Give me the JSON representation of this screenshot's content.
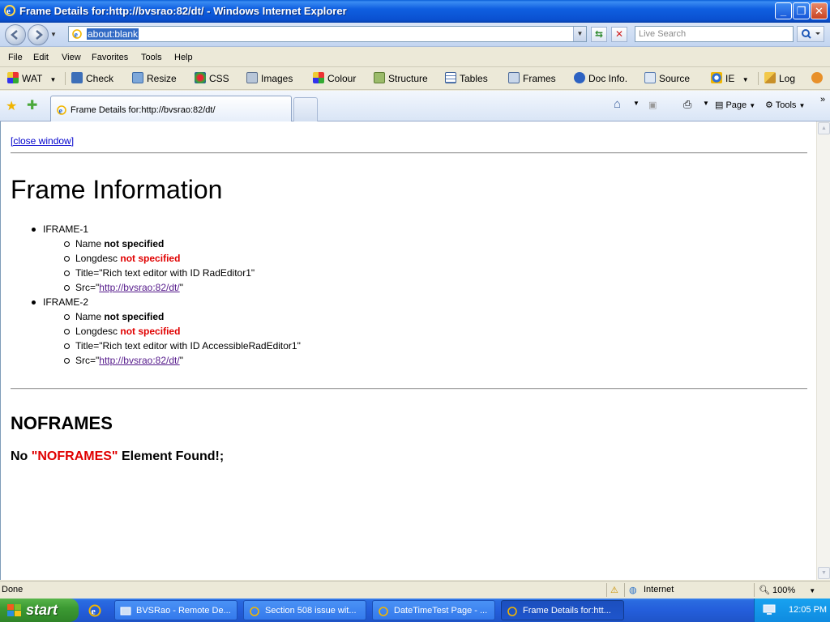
{
  "window": {
    "title": "Frame Details for:http://bvsrao:82/dt/ - Windows Internet Explorer"
  },
  "address_bar": {
    "url": "about:blank",
    "search_placeholder": "Live Search"
  },
  "menu": [
    "File",
    "Edit",
    "View",
    "Favorites",
    "Tools",
    "Help"
  ],
  "wat_toolbar": [
    "WAT",
    "Check",
    "Resize",
    "CSS",
    "Images",
    "Colour",
    "Structure",
    "Tables",
    "Frames",
    "Doc Info.",
    "Source",
    "IE",
    "Log"
  ],
  "tab": {
    "title": "Frame Details for:http://bvsrao:82/dt/"
  },
  "command_bar": {
    "page": "Page",
    "tools": "Tools"
  },
  "document": {
    "close_link": "[close window]",
    "heading": "Frame Information",
    "iframes": [
      {
        "label": "IFRAME-1",
        "name_prefix": "Name ",
        "name_value": "not specified",
        "longdesc_prefix": "Longdesc ",
        "longdesc_value": "not specified",
        "title": "Title=\"Rich text editor with ID RadEditor1\"",
        "src_prefix": "Src=\"",
        "src_link": "http://bvsrao:82/dt/",
        "src_suffix": "\""
      },
      {
        "label": "IFRAME-2",
        "name_prefix": "Name ",
        "name_value": "not specified",
        "longdesc_prefix": "Longdesc ",
        "longdesc_value": "not specified",
        "title": "Title=\"Rich text editor with ID AccessibleRadEditor1\"",
        "src_prefix": "Src=\"",
        "src_link": "http://bvsrao:82/dt/",
        "src_suffix": "\""
      }
    ],
    "noframes_heading": "NOFRAMES",
    "noframes_pre": "No ",
    "noframes_tag": "\"NOFRAMES\"",
    "noframes_post": " Element Found!;"
  },
  "status_bar": {
    "status": "Done",
    "zone": "Internet",
    "zoom": "100%"
  },
  "taskbar": {
    "start": "start",
    "tasks": [
      "BVSRao - Remote De...",
      "Section 508 issue wit...",
      "DateTimeTest Page - ...",
      "Frame Details for:htt..."
    ],
    "clock": "12:05 PM"
  },
  "colors": {
    "titlebar": "#0a50d0",
    "missing_value_red": "#e00000",
    "link_visited": "#551a8b"
  }
}
